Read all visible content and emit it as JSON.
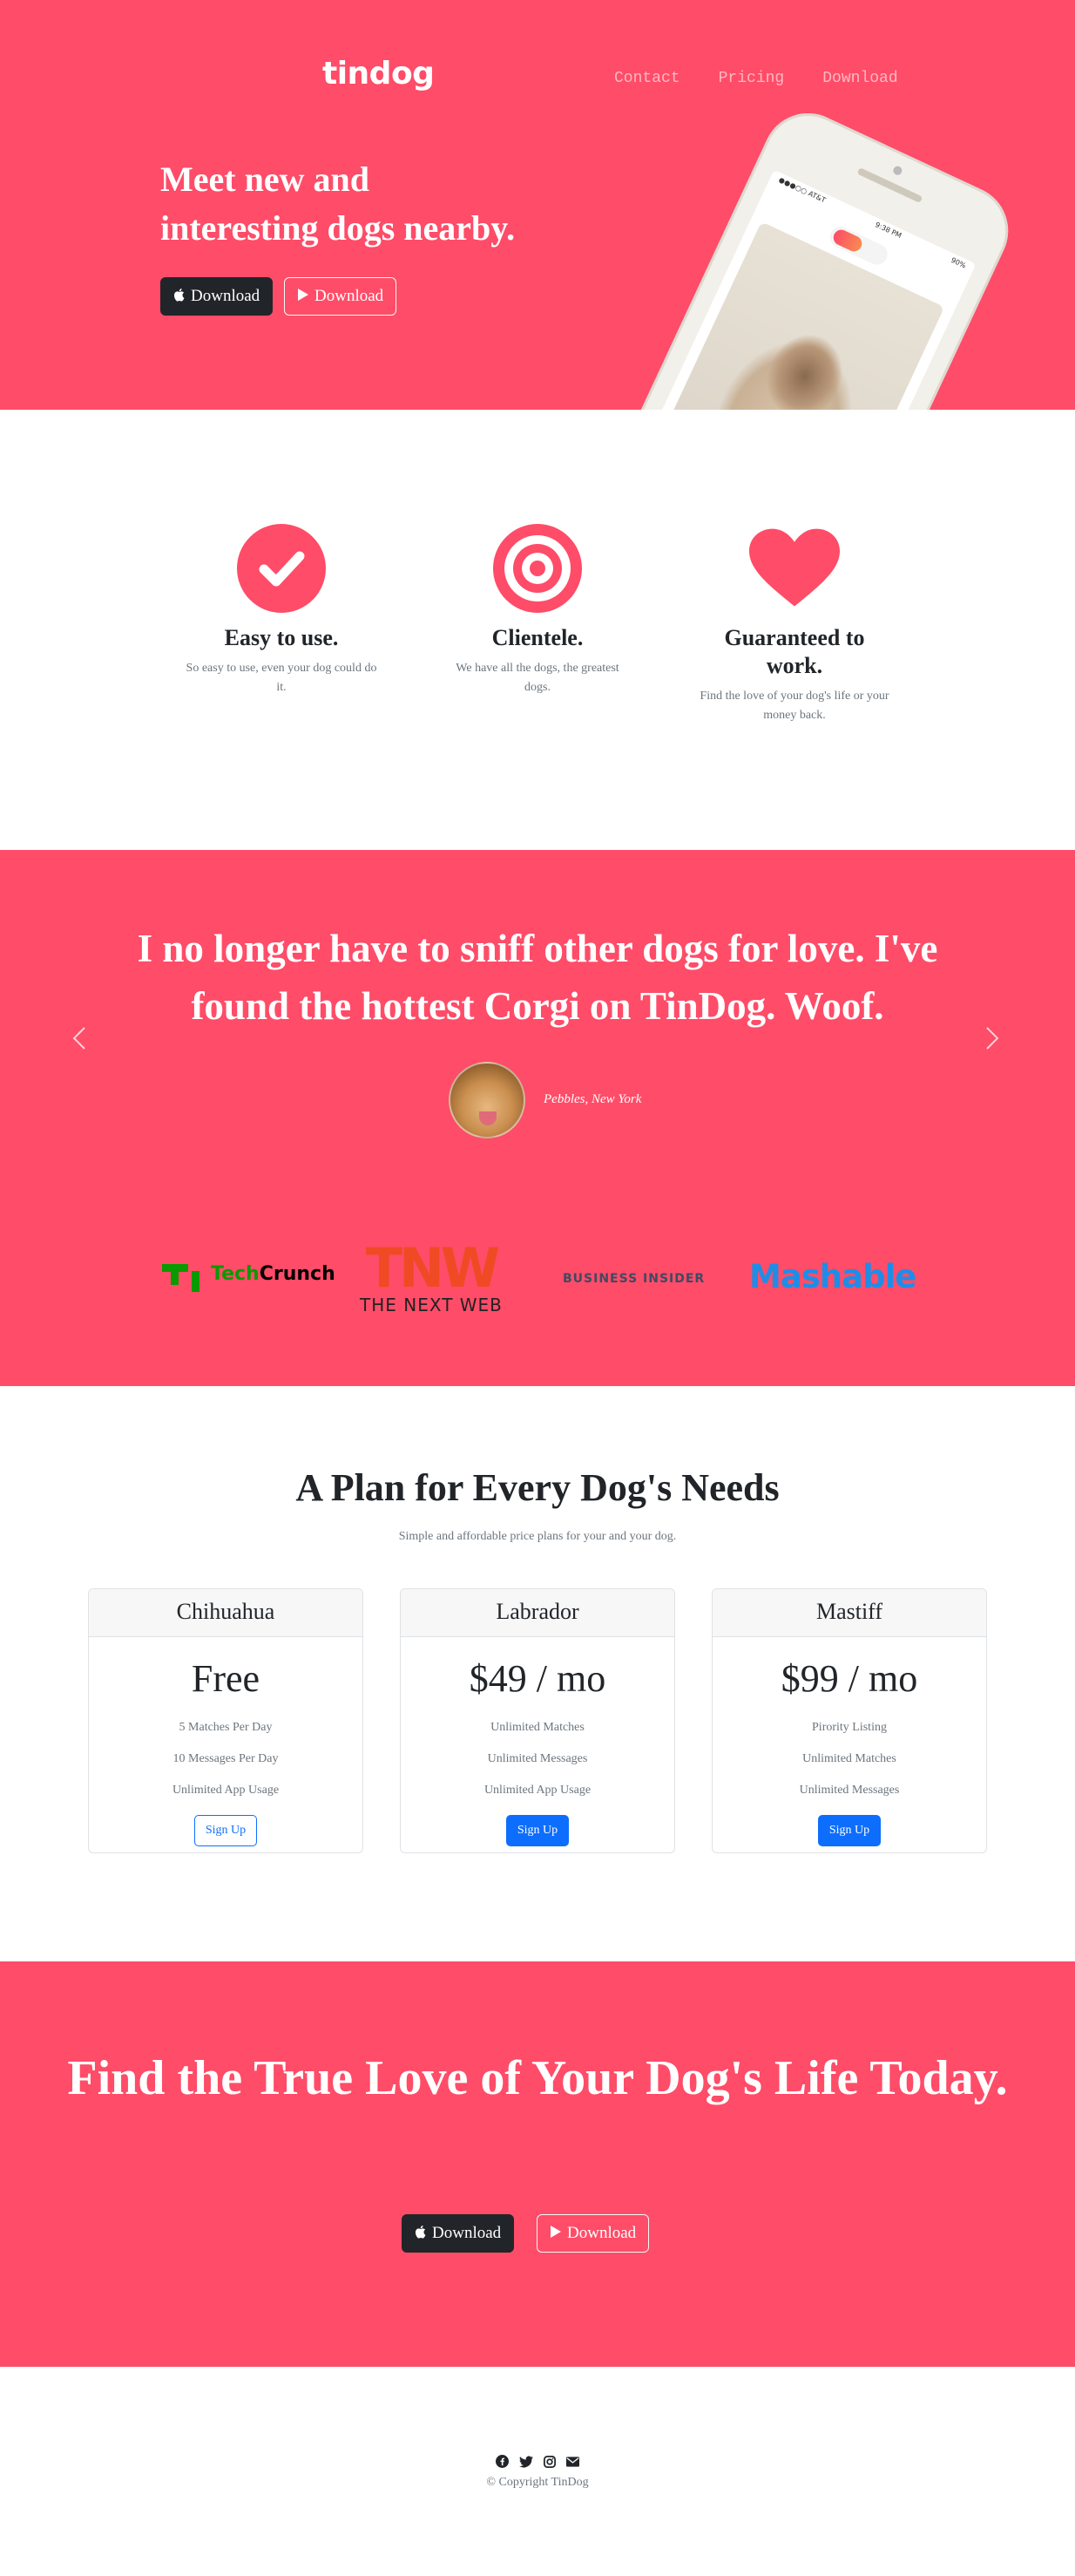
{
  "brand": "tindog",
  "nav": [
    "Contact",
    "Pricing",
    "Download"
  ],
  "hero": {
    "title": "Meet new and interesting dogs nearby.",
    "download_apple": "Download",
    "download_google": "Download"
  },
  "features": [
    {
      "icon": "check-circle-icon",
      "title": "Easy to use.",
      "text": "So easy to use, even your dog could do it."
    },
    {
      "icon": "bullseye-icon",
      "title": "Clientele.",
      "text": "We have all the dogs, the greatest dogs."
    },
    {
      "icon": "heart-icon",
      "title": "Guaranteed to work.",
      "text": "Find the love of your dog's life or your money back."
    }
  ],
  "testimonial": {
    "quote": "I no longer have to sniff other dogs for love. I've found the hottest Corgi on TinDog. Woof.",
    "name": "Pebbles, New York"
  },
  "press": {
    "techcrunch_a": "Tech",
    "techcrunch_b": "Crunch",
    "tnw_big": "TNW",
    "tnw_small": "THE NEXT WEB",
    "business_insider": "BUSINESS INSIDER",
    "mashable": "Mashable"
  },
  "pricing": {
    "title": "A Plan for Every Dog's Needs",
    "subtitle": "Simple and affordable price plans for your and your dog.",
    "plans": [
      {
        "name": "Chihuahua",
        "price": "Free",
        "features": [
          "5 Matches Per Day",
          "10 Messages Per Day",
          "Unlimited App Usage"
        ],
        "button": "Sign Up"
      },
      {
        "name": "Labrador",
        "price": "$49 / mo",
        "features": [
          "Unlimited Matches",
          "Unlimited Messages",
          "Unlimited App Usage"
        ],
        "button": "Sign Up"
      },
      {
        "name": "Mastiff",
        "price": "$99 / mo",
        "features": [
          "Pirority Listing",
          "Unlimited Matches",
          "Unlimited Messages"
        ],
        "button": "Sign Up"
      }
    ]
  },
  "cta": {
    "title": "Find the True Love of Your Dog's Life Today.",
    "download_apple": "Download",
    "download_google": "Download"
  },
  "footer": {
    "copyright": "© Copyright TinDog"
  },
  "colors": {
    "brand": "#ff4c68",
    "dark": "#212529",
    "primary": "#0d6efd"
  }
}
